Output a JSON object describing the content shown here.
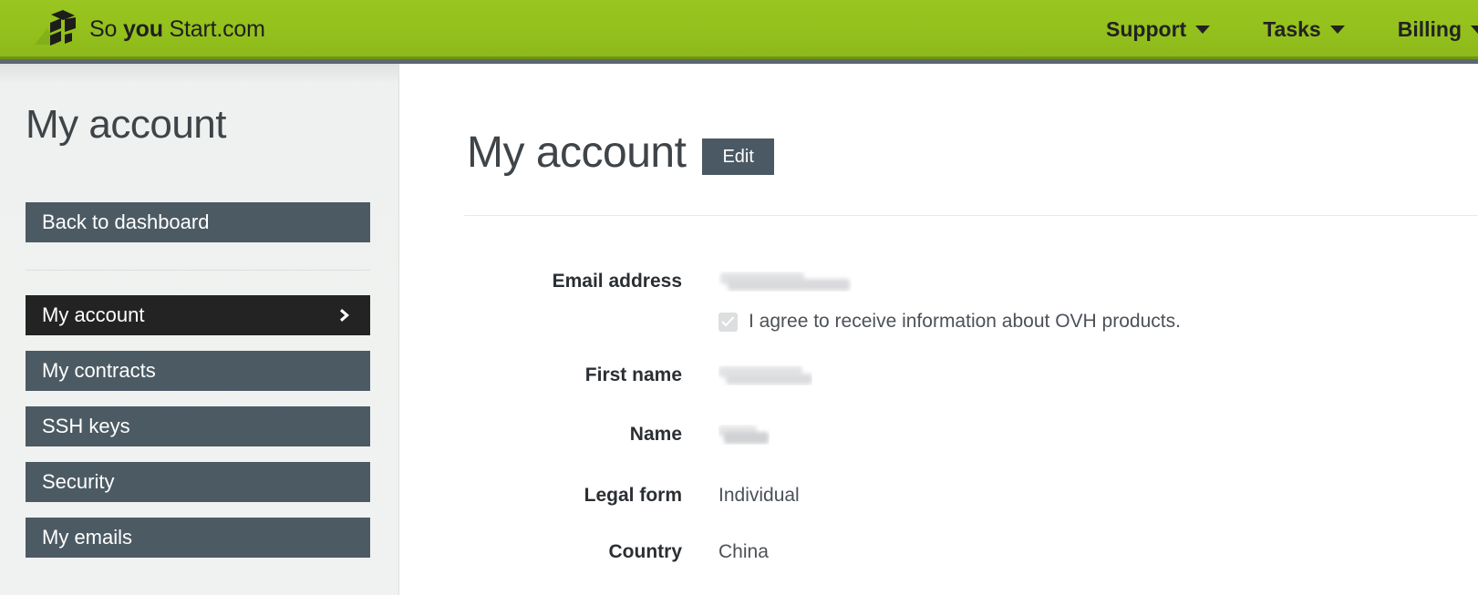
{
  "brand": {
    "logo_icon": "cube-logo-icon",
    "name_part1": "So ",
    "name_bold": "you",
    "name_part2": " Start.com",
    "green": "#93c01c",
    "slate": "#4c5a63",
    "active_dark": "#232323"
  },
  "topnav": {
    "items": [
      {
        "label": "Support",
        "icon": "chevron-down-icon"
      },
      {
        "label": "Tasks",
        "icon": "chevron-down-icon"
      },
      {
        "label": "Billing",
        "icon": "chevron-down-icon"
      }
    ]
  },
  "sidebar": {
    "title": "My account",
    "back_button": "Back to dashboard",
    "items": [
      {
        "label": "My account",
        "active": true,
        "icon": "chevron-right-icon"
      },
      {
        "label": "My contracts",
        "active": false
      },
      {
        "label": "SSH keys",
        "active": false
      },
      {
        "label": "Security",
        "active": false
      },
      {
        "label": "My emails",
        "active": false
      }
    ]
  },
  "main": {
    "title": "My account",
    "edit_label": "Edit",
    "fields": [
      {
        "label": "Email address",
        "value": "",
        "redacted": true
      },
      {
        "label": "First name",
        "value": "",
        "redacted": true
      },
      {
        "label": "Name",
        "value": "",
        "redacted": true
      },
      {
        "label": "Legal form",
        "value": "Individual",
        "redacted": false
      },
      {
        "label": "Country",
        "value": "China",
        "redacted": false
      }
    ],
    "agreement": {
      "checked": true,
      "text": "I agree to receive information about OVH products."
    }
  }
}
